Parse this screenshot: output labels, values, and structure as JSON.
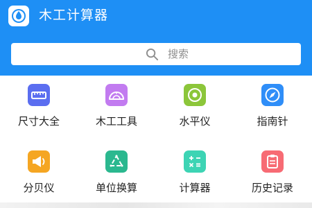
{
  "header": {
    "title": "木工计算器",
    "bg_color": "#1e8ff5"
  },
  "search": {
    "placeholder": "搜索",
    "icon": "search-icon"
  },
  "tiles": [
    {
      "label": "尺寸大全",
      "icon": "ruler-icon",
      "color": "#5b6ef0"
    },
    {
      "label": "木工工具",
      "icon": "protractor-icon",
      "color": "#c27bf0"
    },
    {
      "label": "水平仪",
      "icon": "level-icon",
      "color": "#8cc63a"
    },
    {
      "label": "指南针",
      "icon": "compass-icon",
      "color": "#2f8ef8"
    },
    {
      "label": "分贝仪",
      "icon": "megaphone-icon",
      "color": "#f5a623"
    },
    {
      "label": "单位换算",
      "icon": "recycle-icon",
      "color": "#2bb88f"
    },
    {
      "label": "计算器",
      "icon": "calculator-icon",
      "color": "#3dd4b4"
    },
    {
      "label": "历史记录",
      "icon": "clipboard-icon",
      "color": "#f76b74"
    }
  ]
}
